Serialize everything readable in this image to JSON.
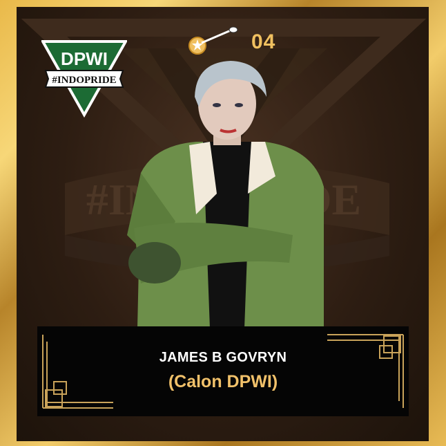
{
  "badge": {
    "logo_title": "DPWI",
    "logo_tagline": "#INDOPRIDE",
    "background_text": "#INDOPRIDE",
    "coin_icon": "coin-icon",
    "coin_count": "04"
  },
  "profile": {
    "name": "JAMES B GOVRYN",
    "role": "(Calon DPWI)"
  },
  "colors": {
    "gold": "#f0c060",
    "logo_green": "#1c6b34",
    "panel": "#2a1a0f"
  }
}
